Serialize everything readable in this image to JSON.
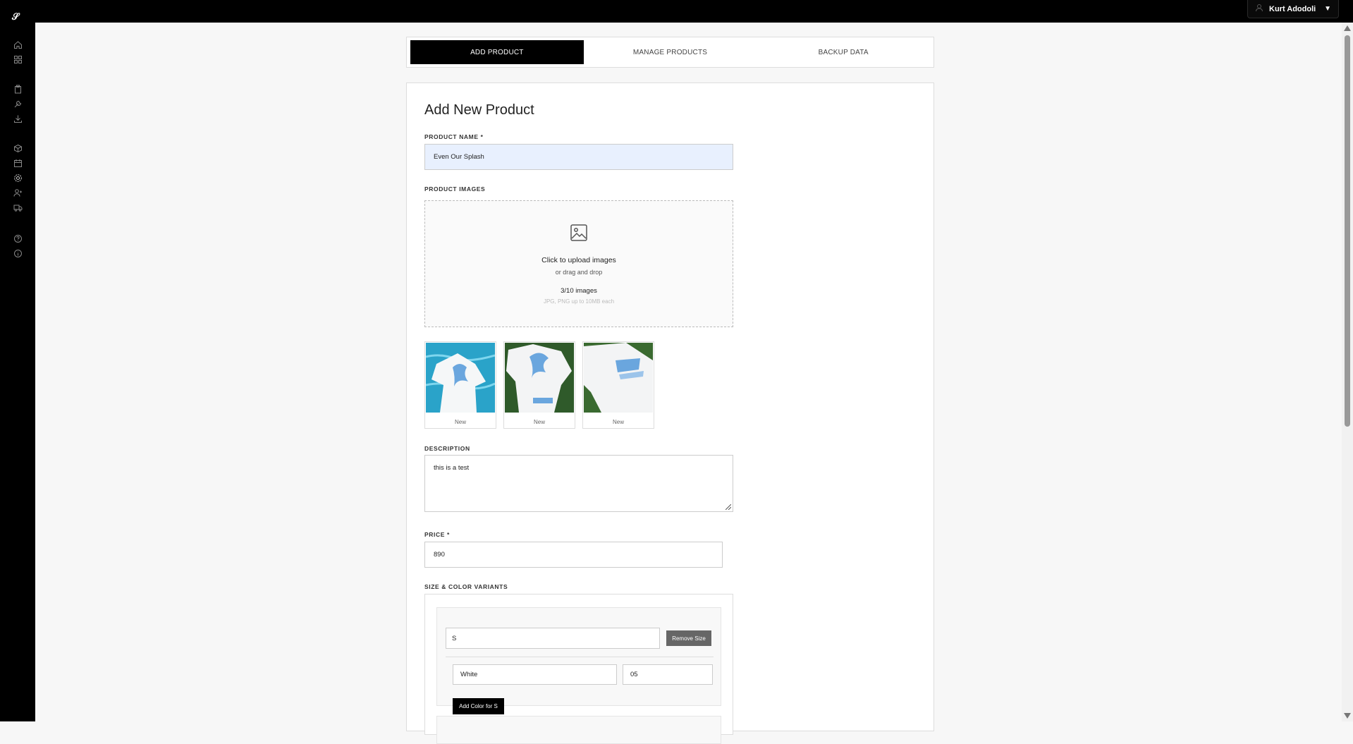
{
  "app": {
    "logo_text": "𝒮"
  },
  "user_menu": {
    "name": "Kurt Adodoli",
    "caret": "▼"
  },
  "sidebar": {
    "icons": [
      "home-icon",
      "grid-icon",
      "clipboard-icon",
      "wrench-icon",
      "download-icon",
      "box-icon",
      "calendar-icon",
      "gear-icon",
      "user-add-icon",
      "truck-icon",
      "help-icon",
      "info-icon"
    ]
  },
  "tabs": [
    {
      "label": "ADD PRODUCT",
      "active": true
    },
    {
      "label": "MANAGE PRODUCTS",
      "active": false
    },
    {
      "label": "BACKUP DATA",
      "active": false
    }
  ],
  "form": {
    "title": "Add New Product",
    "product_name_label": "PRODUCT NAME *",
    "product_name_value": "Even Our Splash",
    "images_label": "PRODUCT IMAGES",
    "upload_title": "Click to upload images",
    "upload_sub": "or drag and drop",
    "upload_count": "3/10 images",
    "upload_hint": "JPG, PNG up to 10MB each",
    "images": [
      {
        "caption": "New"
      },
      {
        "caption": "New"
      },
      {
        "caption": "New"
      }
    ],
    "description_label": "DESCRIPTION",
    "description_value": "this is a test",
    "price_label": "PRICE *",
    "price_value": "890",
    "variants_label": "SIZE & COLOR VARIANTS",
    "variant": {
      "size_value": "S",
      "remove_size_label": "Remove Size",
      "color_value": "White",
      "quantity_value": "05",
      "add_color_label": "Add Color for S"
    }
  }
}
